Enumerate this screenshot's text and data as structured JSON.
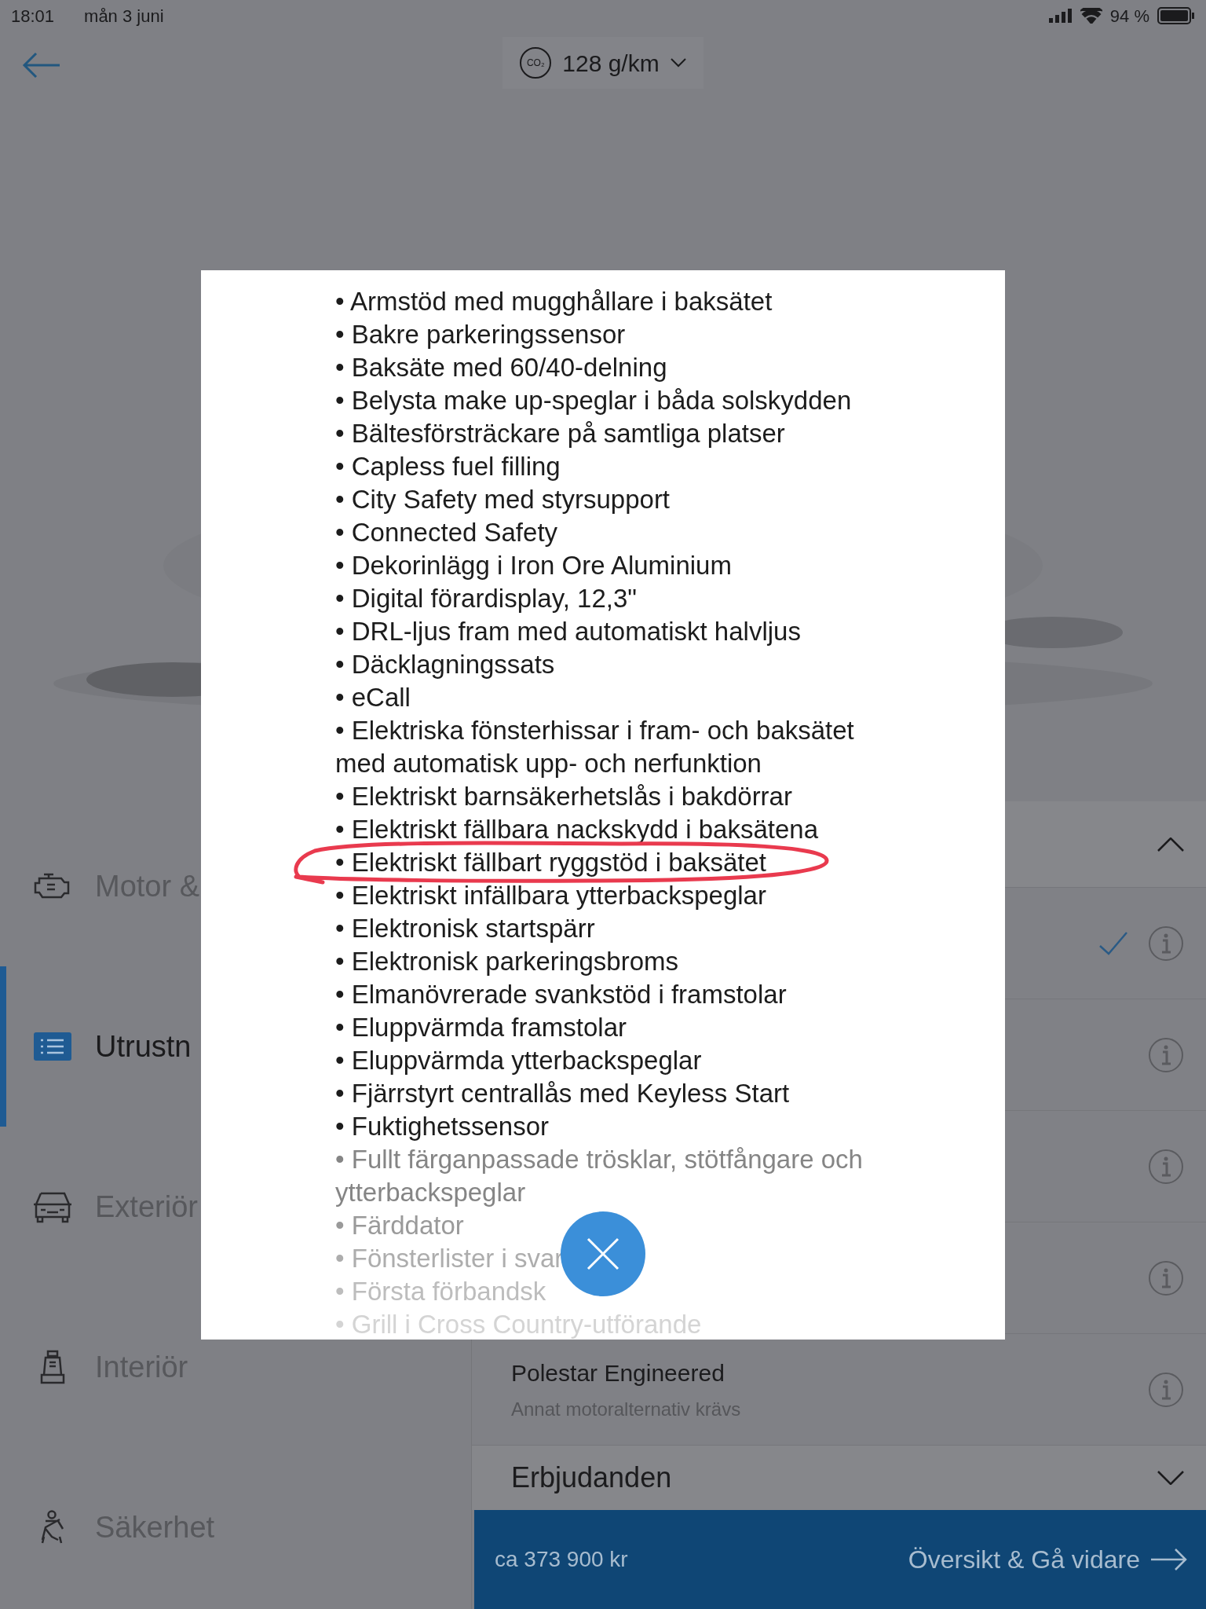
{
  "status_bar": {
    "time": "18:01",
    "date": "mån 3 juni",
    "battery": "94 %"
  },
  "header": {
    "co2_badge": "CO₂",
    "emission": "128 g/km"
  },
  "sidebar": {
    "items": [
      {
        "label": "Motor &",
        "kind": "engine",
        "selected": false
      },
      {
        "label": "Utrustn",
        "kind": "list",
        "selected": true
      },
      {
        "label": "Exteriör",
        "kind": "car",
        "selected": false
      },
      {
        "label": "Interiör",
        "kind": "seat",
        "selected": false
      },
      {
        "label": "Säkerhet",
        "kind": "belt",
        "selected": false
      }
    ]
  },
  "panel": {
    "expanded": true,
    "rows": [
      {
        "checked": true
      },
      {
        "checked": false
      },
      {
        "checked": false
      },
      {
        "checked": false
      },
      {
        "title": "Polestar Engineered",
        "subtitle": "Annat motoralternativ krävs",
        "checked": false
      }
    ],
    "section": {
      "title": "Erbjudanden",
      "expanded": false
    }
  },
  "footer": {
    "price": "ca 373 900 kr",
    "action": "Översikt & Gå vidare"
  },
  "modal": {
    "items": [
      {
        "text": "• Armstöd med mugghållare i baksätet",
        "circled": false
      },
      {
        "text": "• Bakre parkeringssensor",
        "circled": false
      },
      {
        "text": "• Baksäte med 60/40-delning",
        "circled": false
      },
      {
        "text": "• Belysta make up-speglar i båda solskydden",
        "circled": false
      },
      {
        "text": "• Bältesförsträckare på samtliga platser",
        "circled": false
      },
      {
        "text": "• Capless fuel filling",
        "circled": false
      },
      {
        "text": "• City Safety med styrsupport",
        "circled": false
      },
      {
        "text": "• Connected Safety",
        "circled": false
      },
      {
        "text": "• Dekorinlägg i Iron Ore Aluminium",
        "circled": false
      },
      {
        "text": "• Digital förardisplay, 12,3\"",
        "circled": false
      },
      {
        "text": "• DRL-ljus fram med automatiskt halvljus",
        "circled": false
      },
      {
        "text": "• Däcklagningssats",
        "circled": false
      },
      {
        "text": "• eCall",
        "circled": false
      },
      {
        "text": "• Elektriska fönsterhissar i fram- och baksätet med automatisk upp- och nerfunktion",
        "circled": false
      },
      {
        "text": "• Elektriskt barnsäkerhetslås i bakdörrar",
        "circled": false
      },
      {
        "text": "• Elektriskt fällbara nackskydd i baksätena",
        "circled": false
      },
      {
        "text": "• Elektriskt fällbart ryggstöd i baksätet",
        "circled": true
      },
      {
        "text": "• Elektriskt infällbara ytterbackspeglar",
        "circled": false
      },
      {
        "text": "• Elektronisk startspärr",
        "circled": false
      },
      {
        "text": "• Elektronisk parkeringsbroms",
        "circled": false
      },
      {
        "text": "• Elmanövrerade svankstöd i framstolar",
        "circled": false
      },
      {
        "text": "• Eluppvärmda framstolar",
        "circled": false
      },
      {
        "text": "• Eluppvärmda ytterbackspeglar",
        "circled": false
      },
      {
        "text": "• Fjärrstyrt centrallås med Keyless Start",
        "circled": false
      },
      {
        "text": "• Fuktighetssensor",
        "circled": false
      },
      {
        "text": "• Fullt färganpassade trösklar, stötfångare och ytterbackspeglar",
        "circled": false
      },
      {
        "text": "• Färddator",
        "circled": false
      },
      {
        "text": "• Fönsterlister i svar",
        "circled": false
      },
      {
        "text": "• Första förbandsk",
        "circled": false
      },
      {
        "text": "• Grill i Cross Country-utförande",
        "circled": false
      }
    ]
  }
}
